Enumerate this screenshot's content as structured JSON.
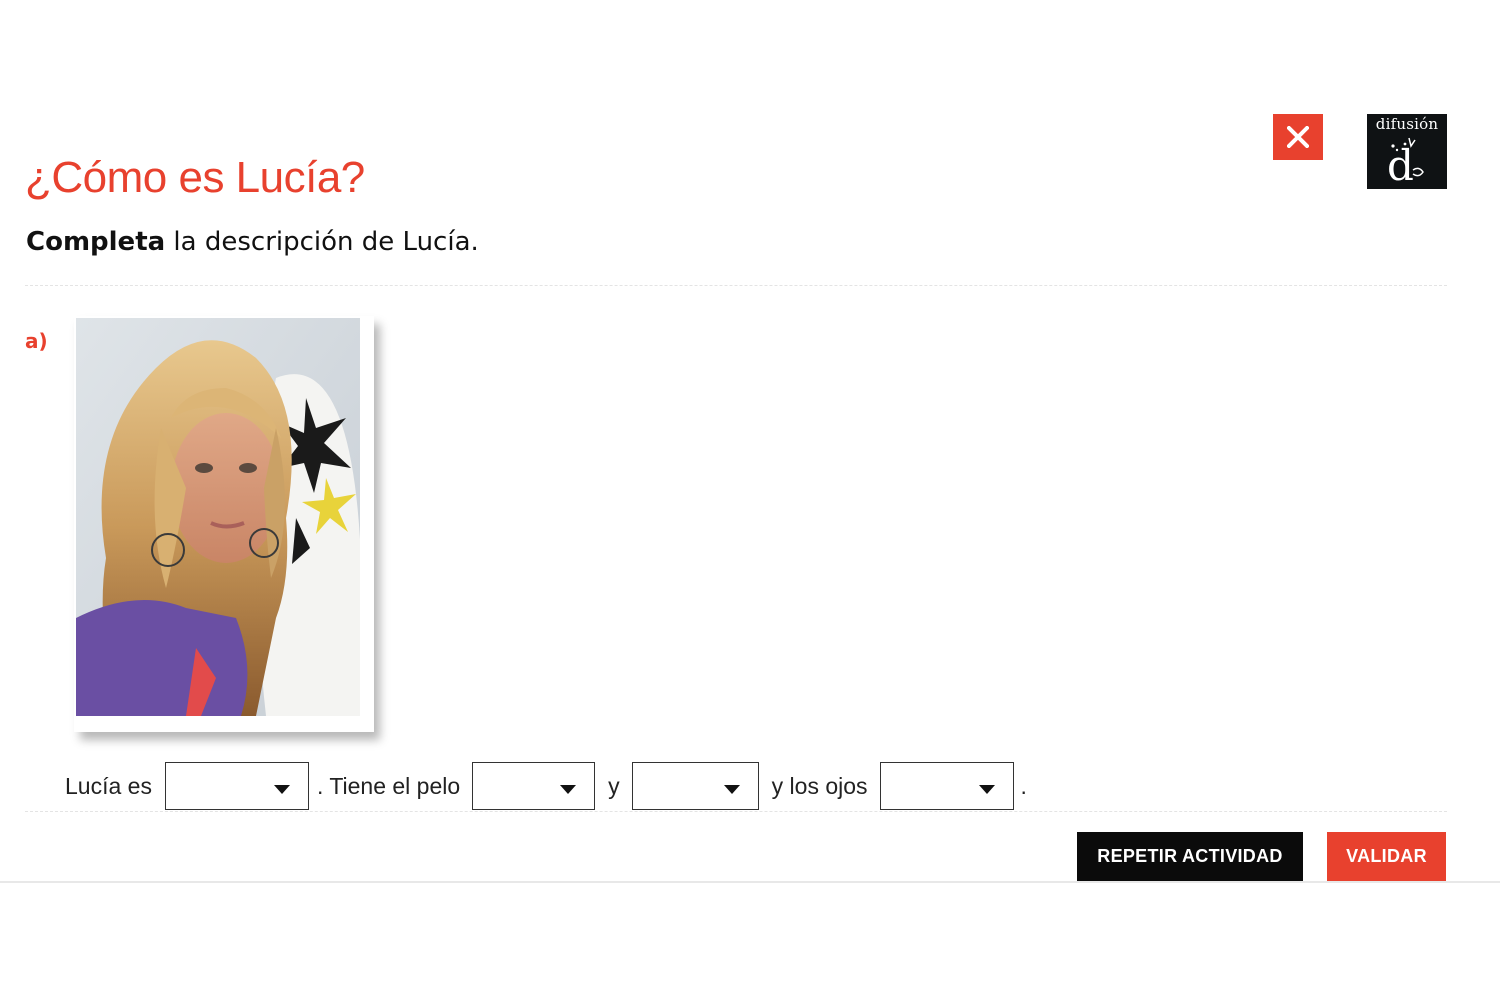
{
  "header": {
    "close_icon": "close-icon",
    "logo_text": "difusión",
    "logo_mark": "d",
    "colors": {
      "accent": "#e8412e",
      "logo_bg": "#0f1214"
    }
  },
  "activity": {
    "title": "¿Cómo es Lucía?",
    "instruction_bold": "Completa",
    "instruction_rest": " la descripción de Lucía."
  },
  "item": {
    "label": "a)",
    "photo_alt": "Lucía",
    "sentence": {
      "part1": "Lucía es",
      "part2": ". Tiene el pelo",
      "part3": "y",
      "part4": "y los ojos",
      "part5": "."
    },
    "selects": [
      {
        "value": ""
      },
      {
        "value": ""
      },
      {
        "value": ""
      },
      {
        "value": ""
      }
    ]
  },
  "actions": {
    "repeat_label": "REPETIR ACTIVIDAD",
    "validate_label": "VALIDAR"
  }
}
